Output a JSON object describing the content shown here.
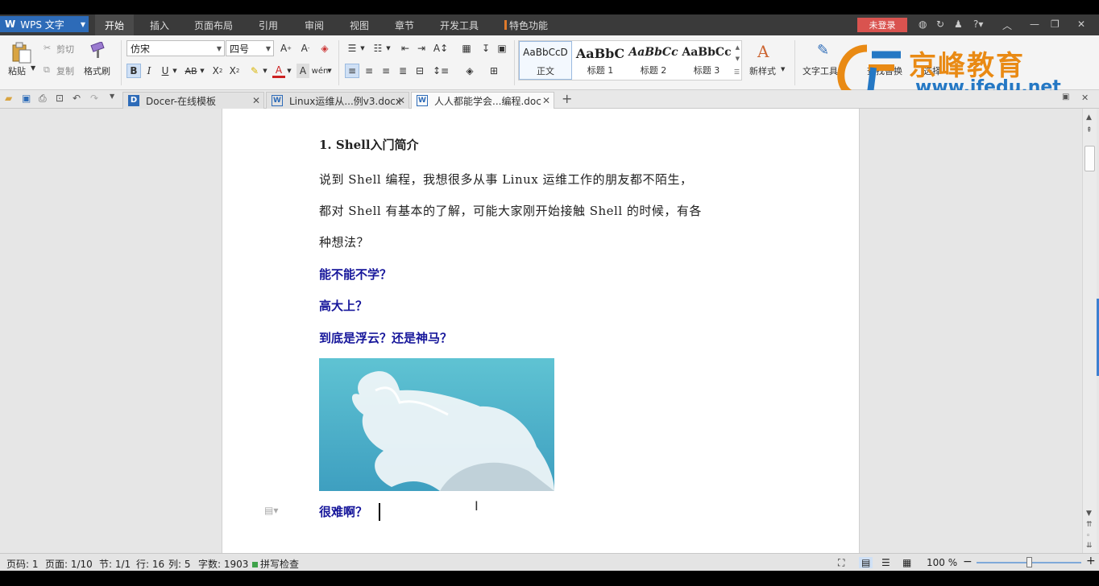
{
  "app": {
    "name": "WPS 文字",
    "logo_letter": "W"
  },
  "menu": {
    "items": [
      "开始",
      "插入",
      "页面布局",
      "引用",
      "审阅",
      "视图",
      "章节",
      "开发工具",
      "特色功能"
    ],
    "login": "未登录"
  },
  "ribbon": {
    "paste": "粘贴",
    "cut": "剪切",
    "copy": "复制",
    "format_painter": "格式刷",
    "font_name": "仿宋",
    "font_size": "四号",
    "styles": [
      {
        "sample": "AaBbCcD",
        "label": "正文"
      },
      {
        "sample": "AaBbC",
        "label": "标题 1"
      },
      {
        "sample": "AaBbCc",
        "label": "标题 2"
      },
      {
        "sample": "AaBbCc",
        "label": "标题 3"
      }
    ],
    "new_style": "新样式",
    "text_tools": "文字工具",
    "find_replace": "查找替换",
    "select": "选择"
  },
  "tabs": [
    {
      "label": "Docer-在线模板",
      "icon": "D"
    },
    {
      "label": "Linux运维从...例v3.docx",
      "icon": "W"
    },
    {
      "label": "人人都能学会...编程.doc",
      "icon": "W"
    }
  ],
  "document": {
    "heading": "1.  Shell入门简介",
    "para_lines": [
      "    说到 Shell 编程，我想很多从事 Linux 运维工作的朋友都不陌生，",
      "都对 Shell 有基本的了解，可能大家刚开始接触 Shell 的时候，有各",
      "种想法？"
    ],
    "blue_lines": [
      "能不能不学？",
      "高大上？",
      "到底是浮云？还是神马？"
    ],
    "last_line": "很难啊？"
  },
  "status": {
    "page": "页码: 1",
    "pages": "页面: 1/10",
    "section": "节: 1/1",
    "row": "行: 16",
    "col": "列: 5",
    "words": "字数: 1903",
    "spell": "拼写检查",
    "zoom": "100 %"
  },
  "watermark": {
    "cn": "京峰教育",
    "url": "www.jfedu.net"
  },
  "colors": {
    "accent": "#2d6bb8",
    "doc_blue": "#17179b",
    "login": "#d9534f"
  }
}
